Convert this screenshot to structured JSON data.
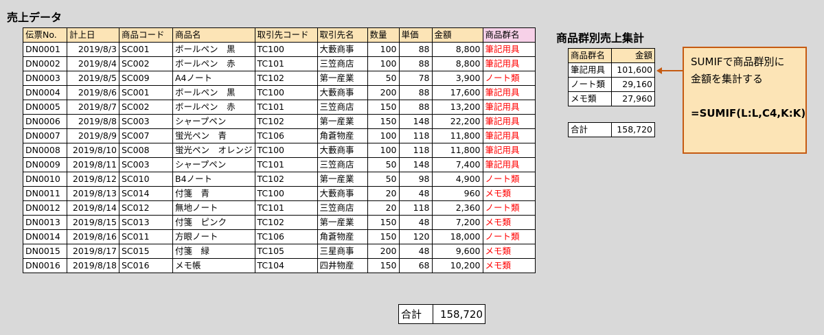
{
  "sales": {
    "title": "売上データ",
    "headers": [
      "伝票No.",
      "計上日",
      "商品コード",
      "商品名",
      "取引先コード",
      "取引先名",
      "数量",
      "単価",
      "金額",
      "商品群名"
    ],
    "rows": [
      [
        "DN0001",
        "2019/8/3",
        "SC001",
        "ボールペン　黒",
        "TC100",
        "大藪商事",
        "100",
        "88",
        "8,800",
        "筆記用具"
      ],
      [
        "DN0002",
        "2019/8/4",
        "SC002",
        "ボールペン　赤",
        "TC101",
        "三笠商店",
        "100",
        "88",
        "8,800",
        "筆記用具"
      ],
      [
        "DN0003",
        "2019/8/5",
        "SC009",
        "A4ノート",
        "TC102",
        "第一産業",
        "50",
        "78",
        "3,900",
        "ノート類"
      ],
      [
        "DN0004",
        "2019/8/6",
        "SC001",
        "ボールペン　黒",
        "TC100",
        "大藪商事",
        "200",
        "88",
        "17,600",
        "筆記用具"
      ],
      [
        "DN0005",
        "2019/8/7",
        "SC002",
        "ボールペン　赤",
        "TC101",
        "三笠商店",
        "150",
        "88",
        "13,200",
        "筆記用具"
      ],
      [
        "DN0006",
        "2019/8/8",
        "SC003",
        "シャープペン",
        "TC102",
        "第一産業",
        "150",
        "148",
        "22,200",
        "筆記用具"
      ],
      [
        "DN0007",
        "2019/8/9",
        "SC007",
        "蛍光ペン　青",
        "TC106",
        "角蒼物産",
        "100",
        "118",
        "11,800",
        "筆記用具"
      ],
      [
        "DN0008",
        "2019/8/10",
        "SC008",
        "蛍光ペン　オレンジ",
        "TC100",
        "大藪商事",
        "100",
        "118",
        "11,800",
        "筆記用具"
      ],
      [
        "DN0009",
        "2019/8/11",
        "SC003",
        "シャープペン",
        "TC101",
        "三笠商店",
        "50",
        "148",
        "7,400",
        "筆記用具"
      ],
      [
        "DN0010",
        "2019/8/12",
        "SC010",
        "B4ノート",
        "TC102",
        "第一産業",
        "50",
        "98",
        "4,900",
        "ノート類"
      ],
      [
        "DN0011",
        "2019/8/13",
        "SC014",
        "付箋　青",
        "TC100",
        "大藪商事",
        "20",
        "48",
        "960",
        "メモ類"
      ],
      [
        "DN0012",
        "2019/8/14",
        "SC012",
        "無地ノート",
        "TC101",
        "三笠商店",
        "20",
        "118",
        "2,360",
        "ノート類"
      ],
      [
        "DN0013",
        "2019/8/15",
        "SC013",
        "付箋　ピンク",
        "TC102",
        "第一産業",
        "150",
        "48",
        "7,200",
        "メモ類"
      ],
      [
        "DN0014",
        "2019/8/16",
        "SC011",
        "方眼ノート",
        "TC106",
        "角蒼物産",
        "150",
        "120",
        "18,000",
        "ノート類"
      ],
      [
        "DN0015",
        "2019/8/17",
        "SC015",
        "付箋　緑",
        "TC105",
        "三星商事",
        "200",
        "48",
        "9,600",
        "メモ類"
      ],
      [
        "DN0016",
        "2019/8/18",
        "SC016",
        "メモ帳",
        "TC104",
        "四井物産",
        "150",
        "68",
        "10,200",
        "メモ類"
      ]
    ],
    "total_label": "合計",
    "total_value": "158,720"
  },
  "summary": {
    "title": "商品群別売上集計",
    "headers": [
      "商品群名",
      "金額"
    ],
    "rows": [
      [
        "筆記用具",
        "101,600"
      ],
      [
        "ノート類",
        "29,160"
      ],
      [
        "メモ類",
        "27,960"
      ]
    ],
    "total_label": "合計",
    "total_value": "158,720"
  },
  "note": {
    "line1": "SUMIFで商品群別に",
    "line2": "金額を集計する",
    "formula": "=SUMIF(L:L,C4,K:K)"
  },
  "colors": {
    "header_bg": "#fce4b6",
    "group_header_bg": "#f7d1e8",
    "group_text": "#ff0000",
    "note_border": "#c55a11",
    "arrow": "#c55a11"
  }
}
